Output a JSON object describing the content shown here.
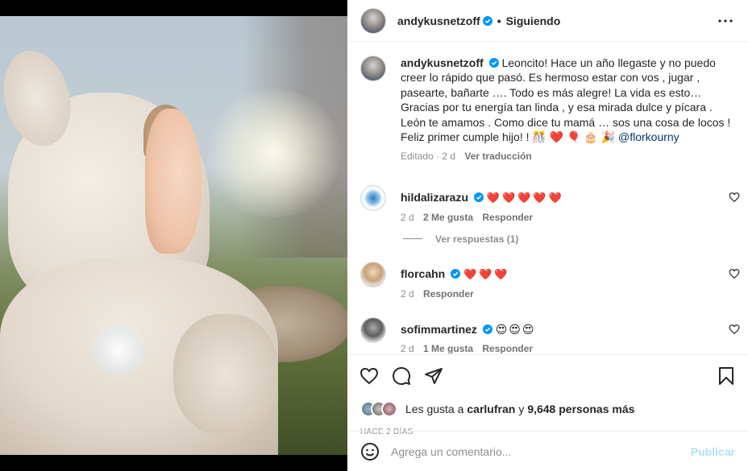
{
  "header": {
    "username": "andykusnetzoff",
    "separator": "•",
    "follow_status": "Siguiendo"
  },
  "caption": {
    "username": "andykusnetzoff",
    "line1": "Leoncito! Hace un año llegaste y no puedo",
    "line2": "creer lo rápido que pasó. Es hermoso estar con vos , jugar ,",
    "line3": "pasearte, bañarte …. Todo es más alegre! La vida es esto…",
    "line4": "Gracias por tu energía tan linda , y esa mirada dulce y pícara .",
    "line5": "León te amamos . Como dice tu mamá … sos una cosa de locos !",
    "line6_text": "Feliz primer cumple hijo! !",
    "line6_emojis": "🎊 ❤️ 🎈 🎂 🎉",
    "mention": "@florkourny",
    "edited": "Editado · 2 d",
    "translate": "Ver traducción"
  },
  "comments": [
    {
      "username": "hildalizarazu",
      "text": "❤️❤️❤️❤️❤️",
      "time": "2 d",
      "likes": "2 Me gusta",
      "reply": "Responder"
    },
    {
      "username": "florcahn",
      "text": "❤️❤️❤️",
      "time": "2 d",
      "likes": "",
      "reply": "Responder"
    },
    {
      "username": "sofimmartinez",
      "text": "😍😍😍",
      "time": "2 d",
      "likes": "1 Me gusta",
      "reply": "Responder"
    }
  ],
  "view_replies": "Ver respuestas (1)",
  "likes": {
    "prefix": "Les gusta a",
    "user": "carlufran",
    "connector": "y",
    "others": "9,648 personas más"
  },
  "posted": "HACE 2 DÍAS",
  "add_comment": {
    "placeholder": "Agrega un comentario...",
    "publish": "Publicar"
  },
  "icons": {
    "more": "more-options-icon",
    "like": "heart-icon",
    "comment": "comment-icon",
    "share": "share-icon",
    "save": "bookmark-icon",
    "emoji": "smiley-icon",
    "verified": "verified-badge-icon"
  },
  "colors": {
    "heart": "#e0245e",
    "verified": "#0095f6",
    "publish_disabled": "#b2dffc",
    "meta": "#8e8e8e"
  }
}
